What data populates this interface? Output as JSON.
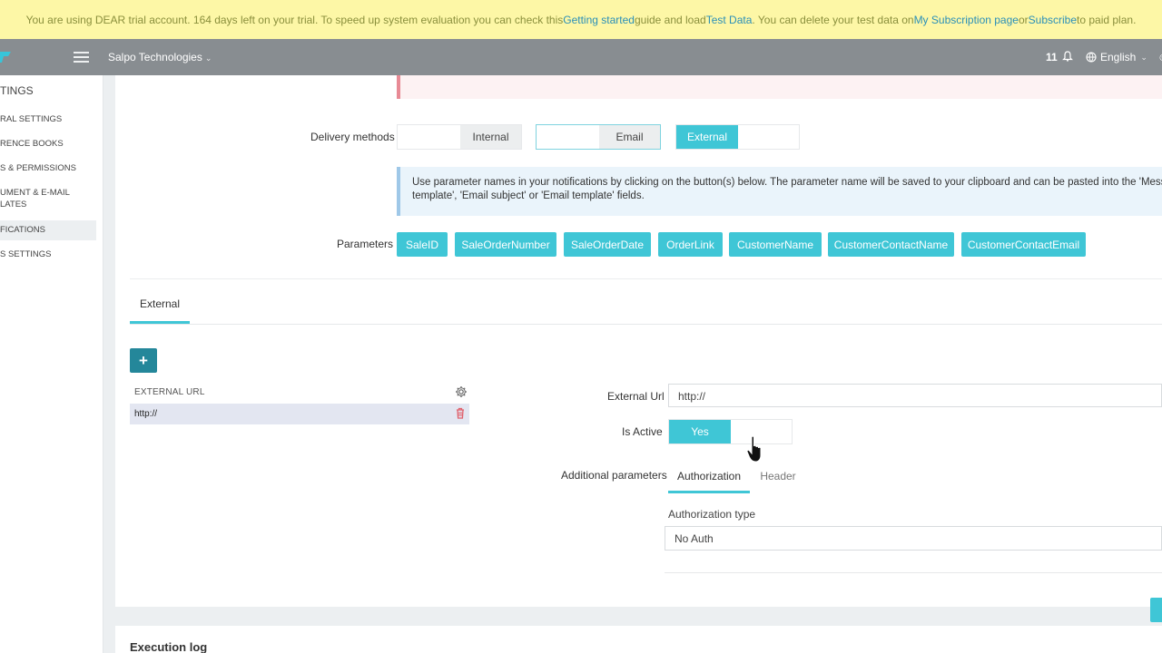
{
  "banner": {
    "t1": "You are using DEAR trial account. 164 days left on your trial. To speed up system evaluation you can check this ",
    "link1": "Getting started",
    "t2": " guide and load ",
    "link2": "Test Data",
    "t3": ". You can delete your test data on ",
    "link3": "My Subscription page",
    "t4": " or ",
    "link4": "Subscribe",
    "t5": " to paid plan."
  },
  "topbar": {
    "company": "Salpo Technologies",
    "notifications_count": "11",
    "language": "English"
  },
  "sidebar": {
    "title": "TINGS",
    "items": [
      {
        "label": "RAL SETTINGS"
      },
      {
        "label": "RENCE BOOKS"
      },
      {
        "label": "S & PERMISSIONS"
      },
      {
        "label": "UMENT & E-MAIL"
      },
      {
        "label": "LATES"
      },
      {
        "label": "FICATIONS"
      },
      {
        "label": "S SETTINGS"
      }
    ]
  },
  "delivery": {
    "label": "Delivery methods",
    "internal": "Internal",
    "email": "Email",
    "external": "External"
  },
  "info_text": {
    "line1": "Use parameter names in your notifications by clicking on the button(s) below. The parameter name will be saved to your clipboard and can be pasted into the 'Messag",
    "line2": "template', 'Email subject' or 'Email template' fields."
  },
  "parameters": {
    "label": "Parameters",
    "buttons": [
      "SaleID",
      "SaleOrderNumber",
      "SaleOrderDate",
      "OrderLink",
      "CustomerName",
      "CustomerContactName",
      "CustomerContactEmail"
    ]
  },
  "tabs": {
    "external": "External"
  },
  "table": {
    "header": "EXTERNAL URL",
    "rows": [
      {
        "url": "http://"
      }
    ]
  },
  "form": {
    "external_url_label": "External Url",
    "external_url_value": "http://",
    "is_active_label": "Is Active",
    "is_active_value": "Yes",
    "additional_label": "Additional parameters",
    "subtab_auth": "Authorization",
    "subtab_header": "Header",
    "auth_type_label": "Authorization type",
    "auth_type_value": "No Auth"
  },
  "execution_log": {
    "title": "Execution log"
  },
  "colors": {
    "accent": "#3fc6d6",
    "dark_accent": "#24879a",
    "banner_bg": "#fdf7a6"
  }
}
